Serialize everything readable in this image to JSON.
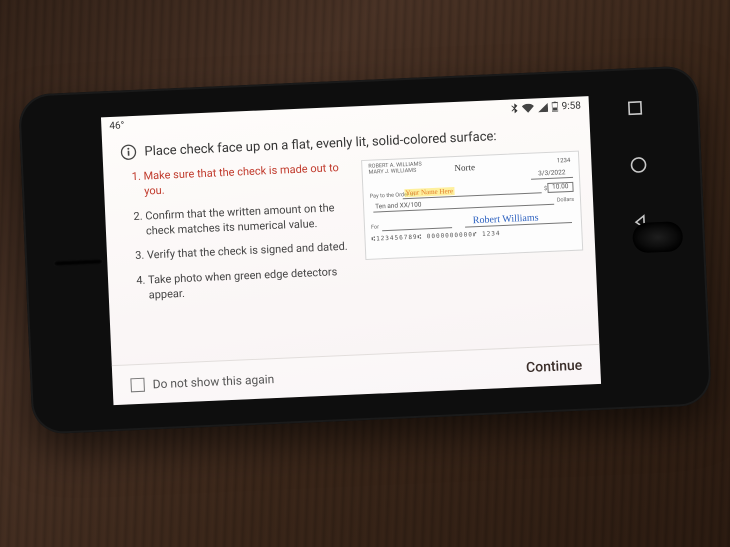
{
  "status_bar": {
    "left": "46°",
    "time": "9:58"
  },
  "header": {
    "instruction": "Place check face up on a flat, evenly lit, solid-colored surface:"
  },
  "steps": [
    "Make sure that the check is made out to you.",
    "Confirm that the written amount on the check matches its numerical value.",
    "Verify that the check is signed and dated.",
    "Take photo when green edge detectors appear."
  ],
  "check": {
    "payer_name": "ROBERT A. WILLIAMS",
    "payer_name2": "MARY J. WILLIAMS",
    "bank_name": "Norte",
    "check_number": "1234",
    "date": "3/3/2022",
    "pay_to_label": "Pay to the Order of",
    "pay_to": "Your Name Here",
    "amount_numeric": "10.00",
    "amount_written": "Ten and XX/100",
    "dollars_label": "Dollars",
    "for_label": "For",
    "signature": "Robert Williams",
    "micr": "⑆123456789⑆  0000000000⑈  1234"
  },
  "footer": {
    "do_not_show": "Do not show this again",
    "continue": "Continue"
  }
}
